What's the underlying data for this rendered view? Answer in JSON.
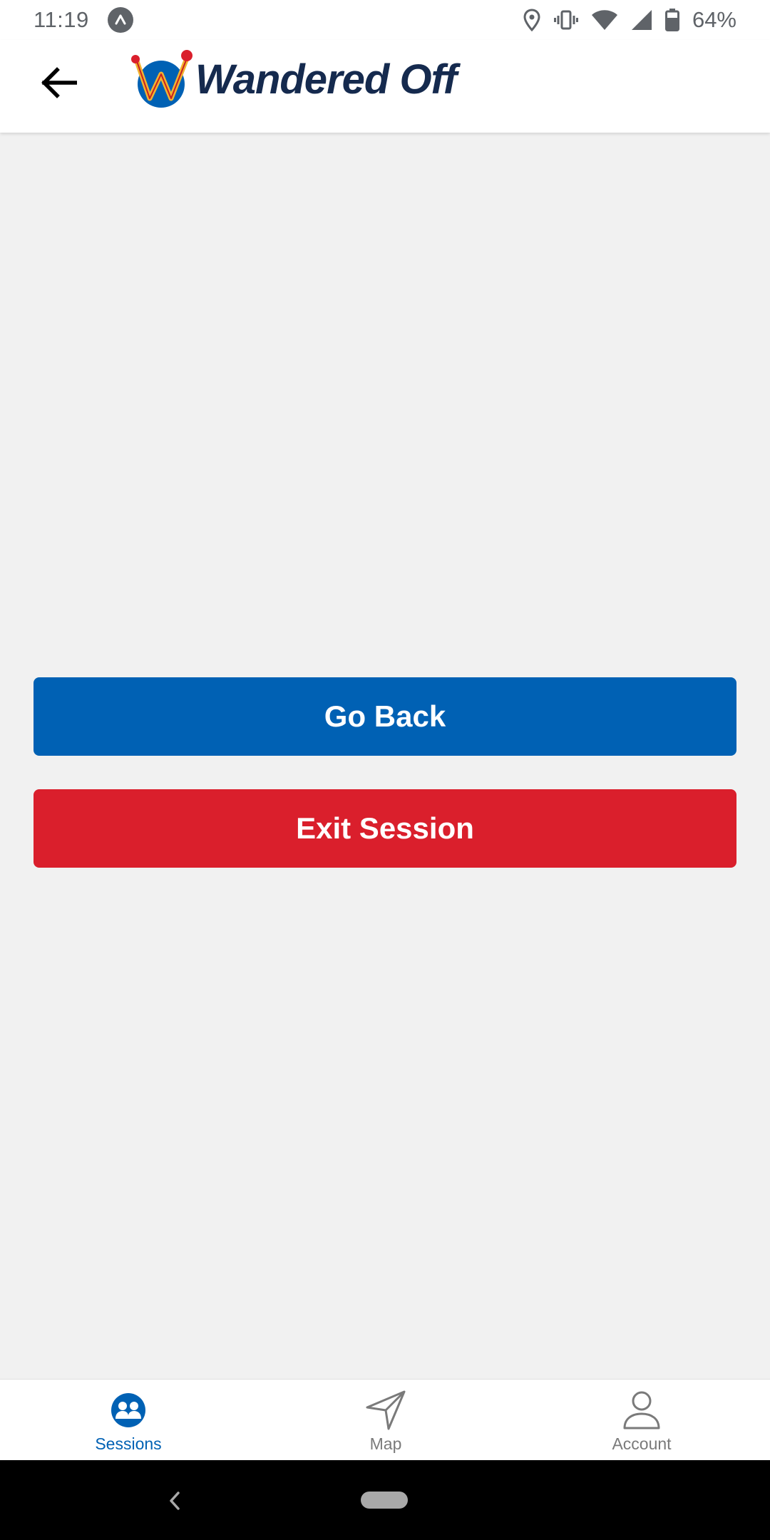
{
  "status_bar": {
    "time": "11:19",
    "battery_percent": "64%",
    "icons": [
      "app-notification-icon",
      "location-icon",
      "vibrate-icon",
      "wifi-icon",
      "cell-signal-icon",
      "battery-icon"
    ]
  },
  "header": {
    "back_icon": "back-arrow-icon",
    "logo_text": "Wandered Off"
  },
  "actions": {
    "go_back_label": "Go Back",
    "exit_session_label": "Exit Session"
  },
  "bottom_nav": {
    "items": [
      {
        "label": "Sessions",
        "icon": "sessions-icon",
        "active": true
      },
      {
        "label": "Map",
        "icon": "navigation-arrow-icon",
        "active": false
      },
      {
        "label": "Account",
        "icon": "person-icon",
        "active": false
      }
    ]
  },
  "colors": {
    "primary_blue": "#0061b4",
    "exit_red": "#da1f2c",
    "logo_navy": "#152a4e",
    "background": "#f1f1f1",
    "inactive_nav": "#7a7a7a"
  }
}
